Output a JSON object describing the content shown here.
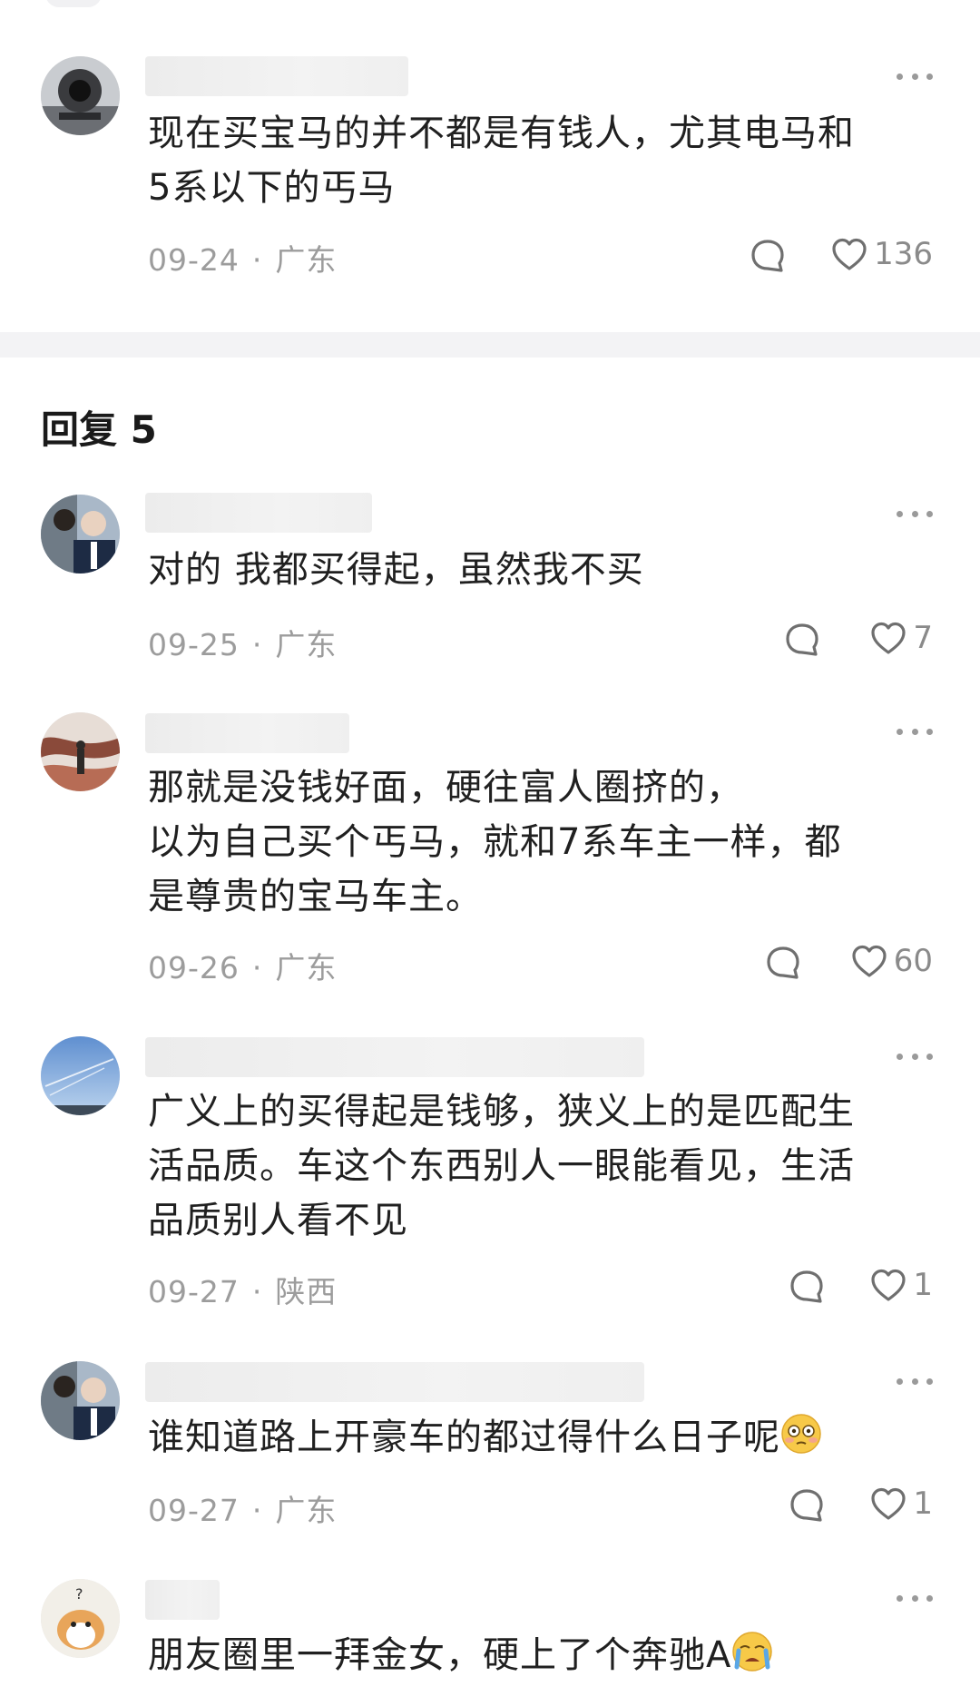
{
  "main_comment": {
    "text_lines": [
      "现在买宝马的并不都是有钱人，尤其电马和",
      "5系以下的丐马"
    ],
    "date": "09-24",
    "location": "广东",
    "likes": "136"
  },
  "replies_section": {
    "title": "回复 5"
  },
  "replies": [
    {
      "text_lines": [
        "对的 我都买得起，虽然我不买"
      ],
      "date": "09-25",
      "location": "广东",
      "likes": "7"
    },
    {
      "text_lines": [
        "那就是没钱好面，硬往富人圈挤的，",
        "以为自己买个丐马，就和7系车主一样，都",
        "是尊贵的宝马车主。"
      ],
      "date": "09-26",
      "location": "广东",
      "likes": "60"
    },
    {
      "text_lines": [
        "广义上的买得起是钱够，狭义上的是匹配生",
        "活品质。车这个东西别人一眼能看见，生活",
        "品质别人看不见"
      ],
      "date": "09-27",
      "location": "陕西",
      "likes": "1"
    },
    {
      "text_lines": [
        "谁知道路上开豪车的都过得什么日子呢"
      ],
      "emoji": "flushed-face-emoji",
      "date": "09-27",
      "location": "广东",
      "likes": "1"
    },
    {
      "text_lines": [
        "朋友圈里一拜金女，硬上了个奔驰A"
      ],
      "emoji": "crying-face-emoji"
    }
  ],
  "icons": {
    "more": "more-dots-icon",
    "reply": "comment-bubble-icon",
    "like": "heart-outline-icon"
  },
  "colors": {
    "text": "#202020",
    "meta": "#9c9c9c",
    "divider": "#f3f3f5"
  }
}
